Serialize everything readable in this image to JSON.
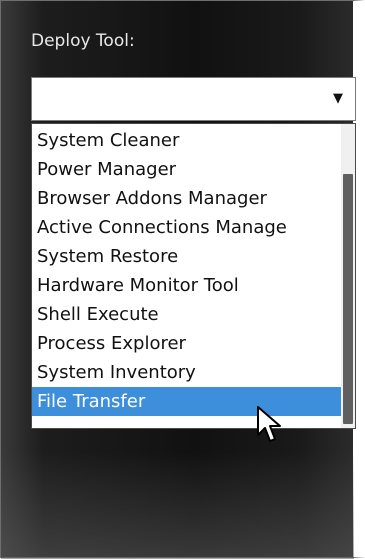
{
  "deploy_tool": {
    "label": "Deploy Tool:",
    "selected_value": "",
    "dropdown_icon": "triangle-down-icon",
    "options": [
      "System Cleaner",
      "Power Manager",
      "Browser Addons Manager",
      "Active Connections Manage",
      "System Restore",
      "Hardware Monitor Tool",
      "Shell Execute",
      "Process Explorer",
      "System Inventory",
      "File Transfer"
    ],
    "highlighted_option": "File Transfer"
  },
  "colors": {
    "highlight": "#3e8fdb",
    "panel_background": "#111111",
    "label_text": "#e8e8e8"
  },
  "cursor_icon": "mouse-pointer-icon"
}
